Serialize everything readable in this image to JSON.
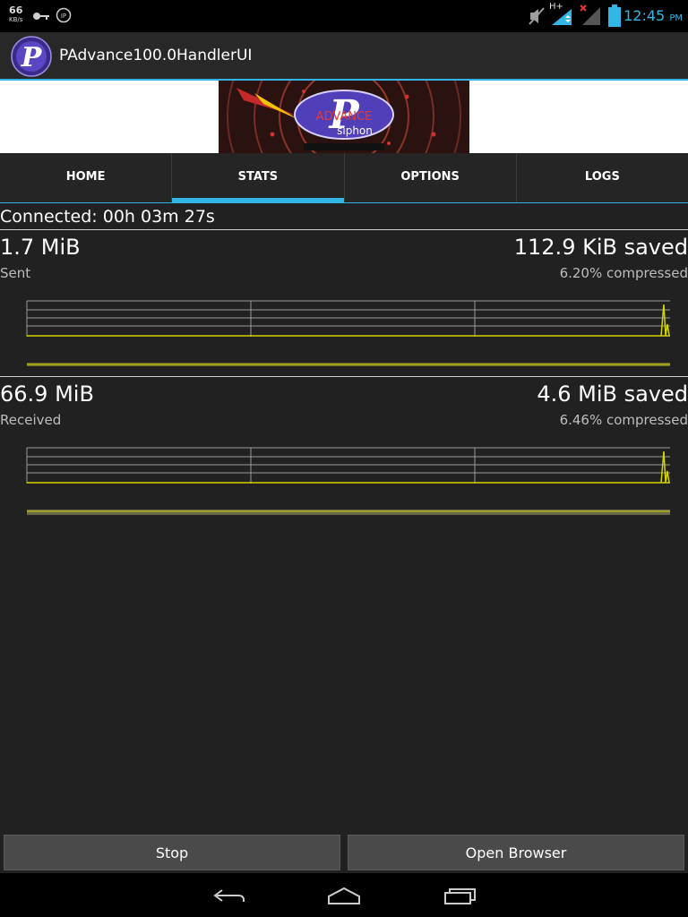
{
  "status_bar": {
    "speed_value": "66",
    "speed_unit": "KB/s",
    "time": "12:45",
    "ampm": "PM",
    "network": "H+",
    "icons": [
      "usb-key-icon",
      "ip-icon",
      "mute-icon",
      "signal-icon",
      "no-signal-icon",
      "battery-icon"
    ]
  },
  "action_bar": {
    "title": "PAdvance100.0HandlerUI"
  },
  "banner": {
    "logo_text_top": "ADVANCE",
    "logo_text_bottom": "siphon"
  },
  "tabs": [
    {
      "label": "HOME",
      "active": false
    },
    {
      "label": "STATS",
      "active": true
    },
    {
      "label": "OPTIONS",
      "active": false
    },
    {
      "label": "LOGS",
      "active": false
    }
  ],
  "stats": {
    "connected": "Connected: 00h 03m 27s",
    "sent": {
      "amount": "1.7 MiB",
      "label": "Sent",
      "saved": "112.9 KiB saved",
      "compressed": "6.20% compressed"
    },
    "received": {
      "amount": "66.9 MiB",
      "label": "Received",
      "saved": "4.6 MiB saved",
      "compressed": "6.46% compressed"
    }
  },
  "buttons": {
    "stop": "Stop",
    "open_browser": "Open Browser"
  },
  "nav": {
    "icons": [
      "back-icon",
      "home-icon",
      "recent-apps-icon"
    ]
  },
  "colors": {
    "accent": "#33b5e5",
    "graph_line": "#d4d400",
    "background": "#212121"
  }
}
